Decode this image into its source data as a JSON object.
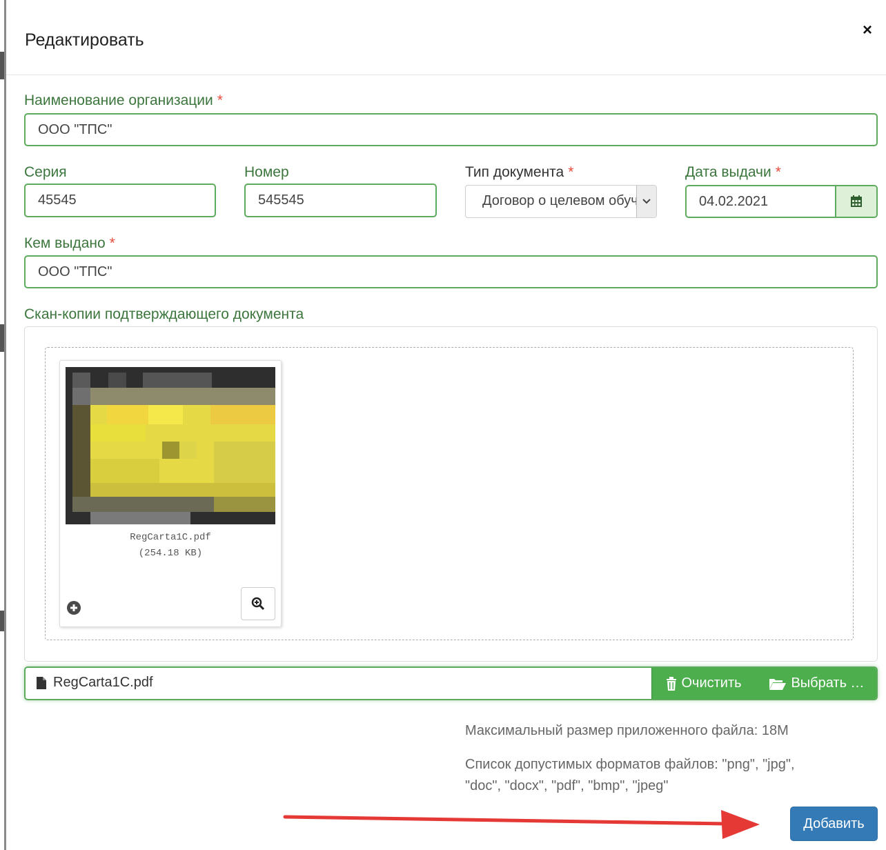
{
  "modal": {
    "title": "Редактировать",
    "close_icon": "×"
  },
  "form": {
    "org_name": {
      "label": "Наименование организации",
      "required_mark": "*",
      "value": "ООО \"ТПС\""
    },
    "series": {
      "label": "Серия",
      "value": "45545"
    },
    "number": {
      "label": "Номер",
      "value": "545545"
    },
    "doc_type": {
      "label": "Тип документа",
      "required_mark": "*",
      "selected": "Договор о целевом обучении"
    },
    "issue_date": {
      "label": "Дата выдачи",
      "required_mark": "*",
      "value": "04.02.2021",
      "icon": "calendar-icon"
    },
    "issued_by": {
      "label": "Кем выдано",
      "required_mark": "*",
      "value": "ООО \"ТПС\""
    }
  },
  "upload": {
    "label": "Скан-копии подтверждающего документа",
    "preview": {
      "file_name": "RegCarta1C.pdf",
      "file_size": "(254.18 KB)",
      "zoom_icon": "zoom-in-icon",
      "extra_icon": "plus-circle-icon"
    },
    "caption": "RegCarta1C.pdf",
    "clear_label": "Очистить",
    "browse_label": "Выбрать …",
    "max_size_text": "Максимальный размер приложенного файла: 18M",
    "formats_line1": "Список допустимых форматов файлов: \"png\", \"jpg\",",
    "formats_line2": "\"doc\", \"docx\", \"pdf\", \"bmp\", \"jpeg\""
  },
  "footer": {
    "submit_label": "Добавить"
  },
  "colors": {
    "field_label": "#3c763d",
    "field_border": "#5cab5c",
    "required": "#e74c3c",
    "button_green": "#4cae4c",
    "button_primary": "#337ab7",
    "annotation_arrow": "#e53935"
  }
}
